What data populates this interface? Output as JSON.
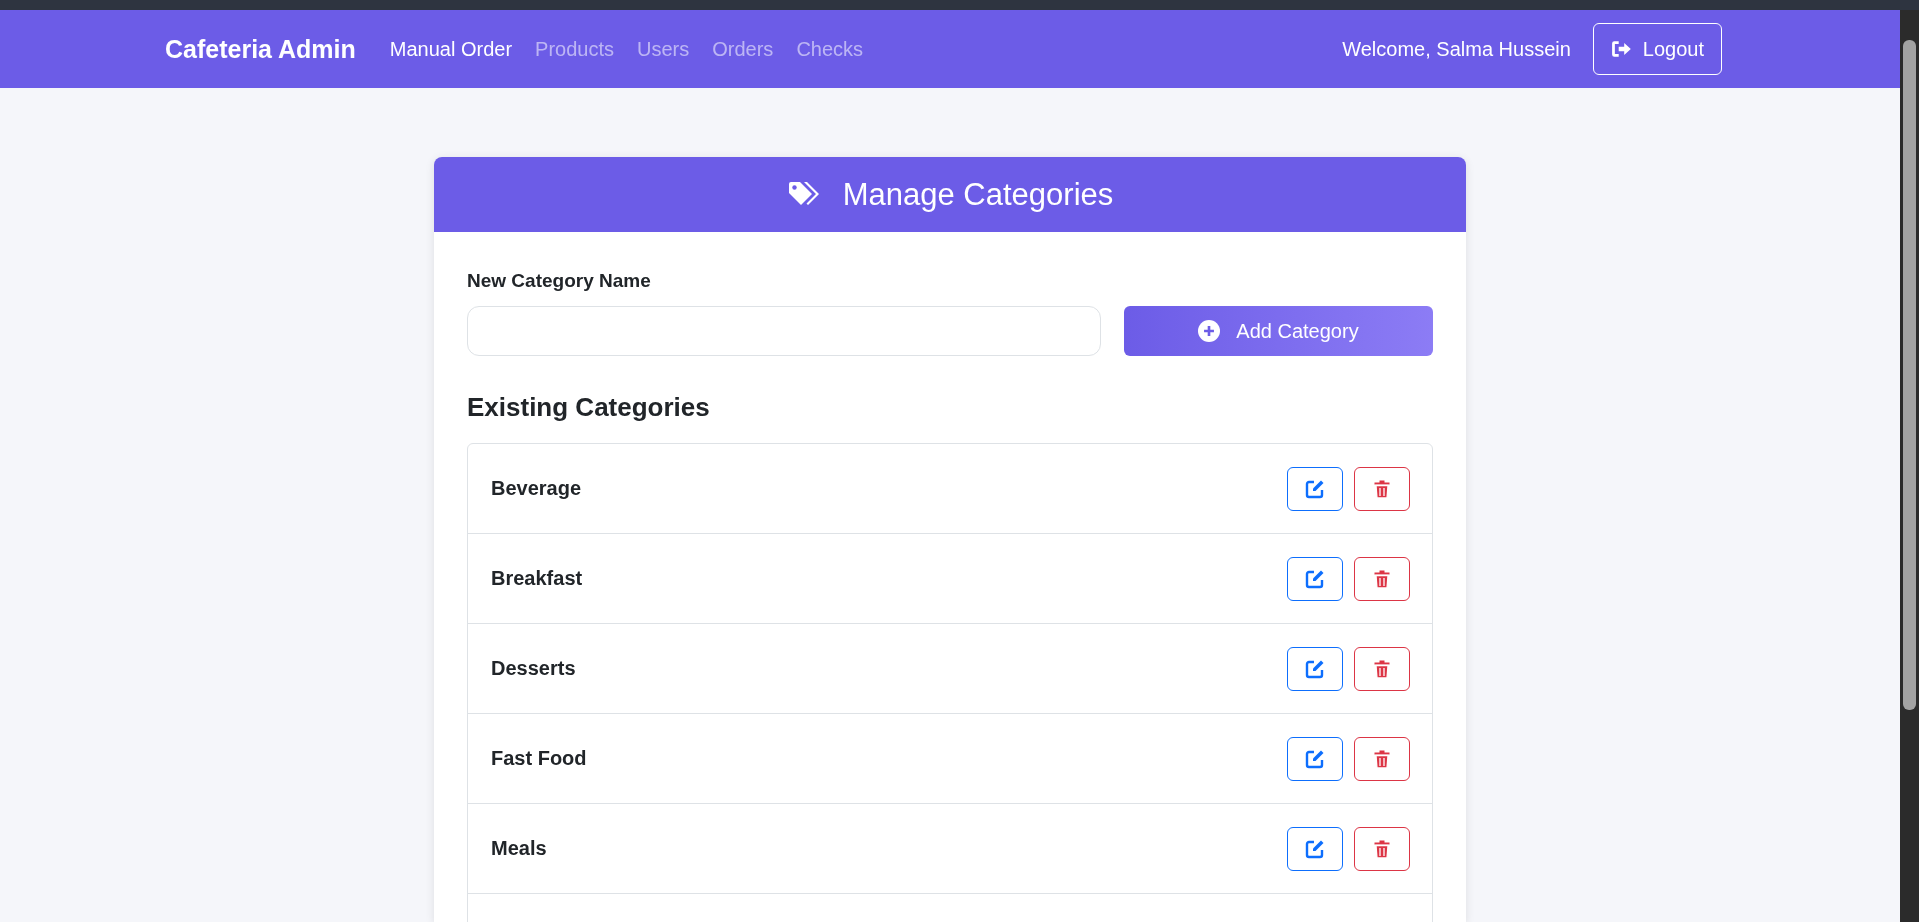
{
  "navbar": {
    "brand": "Cafeteria Admin",
    "links": [
      {
        "label": "Manual Order",
        "selected": true
      },
      {
        "label": "Products",
        "selected": false
      },
      {
        "label": "Users",
        "selected": false
      },
      {
        "label": "Orders",
        "selected": false
      },
      {
        "label": "Checks",
        "selected": false
      }
    ],
    "welcome": "Welcome, Salma Hussein",
    "logout": "Logout"
  },
  "card": {
    "title": "Manage Categories",
    "field_label": "New Category Name",
    "add_button": "Add Category",
    "list_heading": "Existing Categories",
    "categories": [
      {
        "name": "Beverage"
      },
      {
        "name": "Breakfast"
      },
      {
        "name": "Desserts"
      },
      {
        "name": "Fast Food"
      },
      {
        "name": "Meals"
      }
    ]
  }
}
